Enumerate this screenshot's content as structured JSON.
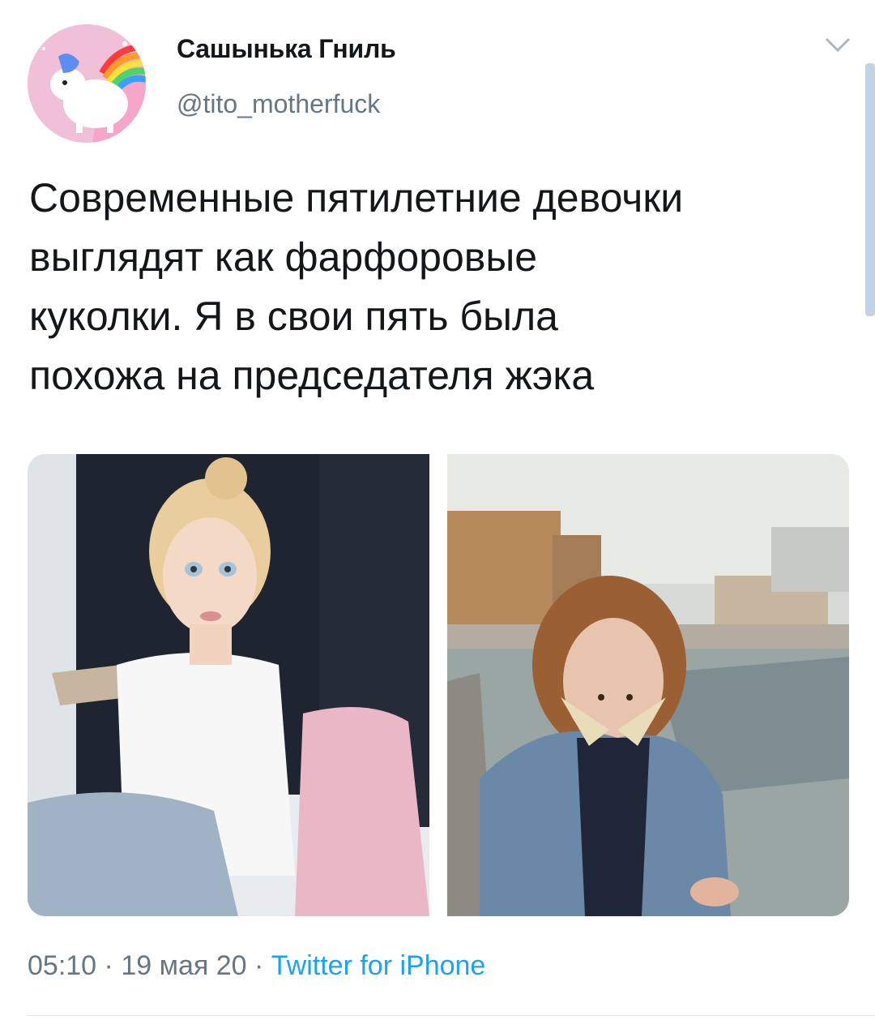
{
  "author": {
    "name": "Сашынька Гниль",
    "handle": "@tito_motherfuck"
  },
  "tweet": {
    "text": "Современные пятилетние девочки\nвыглядят как фарфоровые\nкуколки. Я в свои пять была\nпохожа на председателя жэка"
  },
  "meta": {
    "time": "05:10",
    "sep1": " · ",
    "date": "19 мая 20",
    "sep2": " · ",
    "source": "Twitter for iPhone"
  },
  "icons": {
    "menu": "chevron-down-icon",
    "avatar": "unicorn-avatar"
  },
  "colors": {
    "link": "#1da1f2",
    "secondary": "#657786",
    "text": "#14171a"
  }
}
